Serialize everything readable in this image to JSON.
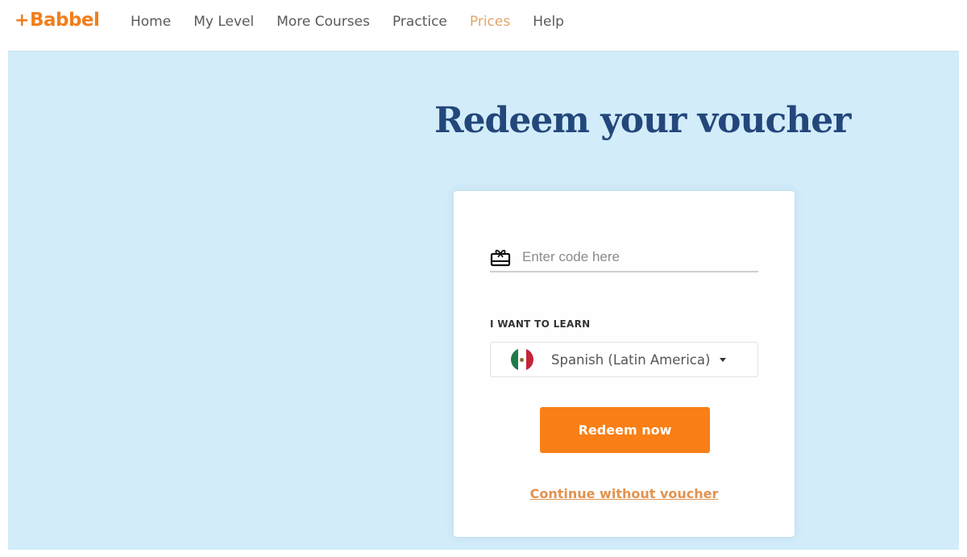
{
  "header": {
    "logo": {
      "plus": "+",
      "text": "Babbel"
    },
    "nav": [
      {
        "label": "Home",
        "active": false
      },
      {
        "label": "My Level",
        "active": false
      },
      {
        "label": "More Courses",
        "active": false
      },
      {
        "label": "Practice",
        "active": false
      },
      {
        "label": "Prices",
        "active": true
      },
      {
        "label": "Help",
        "active": false
      }
    ]
  },
  "main": {
    "title": "Redeem your voucher",
    "form": {
      "code_icon": "gift-icon",
      "code_value": "",
      "code_placeholder": "Enter code here",
      "learn_label": "I WANT TO LEARN",
      "language": {
        "flag": "mexico-flag",
        "selected": "Spanish (Latin America)"
      },
      "redeem_label": "Redeem now",
      "continue_label": "Continue without voucher"
    }
  },
  "colors": {
    "brand": "#f07f1c",
    "button": "#f97f16",
    "title": "#23477a",
    "background": "#d2ecfa",
    "active_nav": "#e2a46b"
  }
}
